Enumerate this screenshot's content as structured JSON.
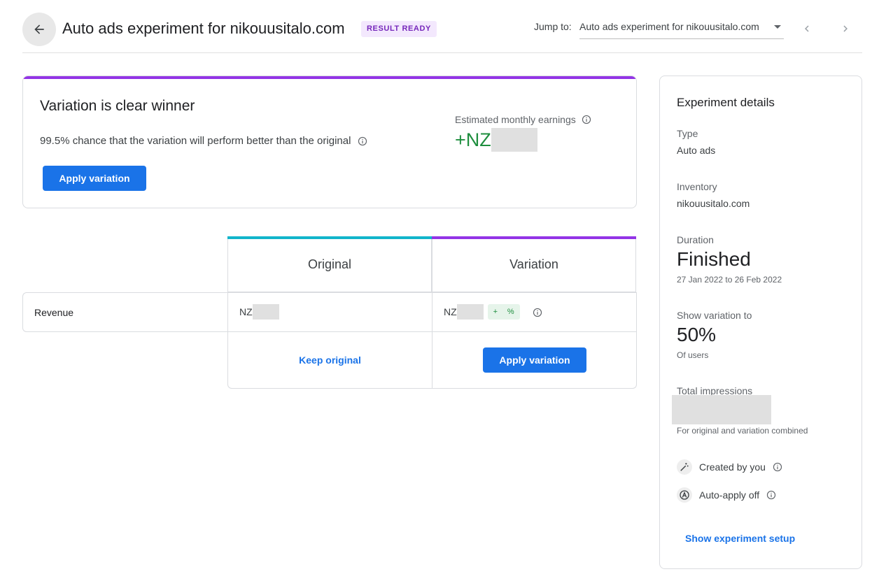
{
  "header": {
    "title": "Auto ads experiment for nikouusitalo.com",
    "status_badge": "RESULT READY",
    "jump_label": "Jump to:",
    "jump_value": "Auto ads experiment for nikouusitalo.com",
    "icons": [
      "arrow-back-icon",
      "chevron-left-icon",
      "chevron-right-icon",
      "dropdown-caret-icon"
    ]
  },
  "winner": {
    "title": "Variation is clear winner",
    "description": "99.5% chance that the variation will perform better than the original",
    "apply_label": "Apply variation",
    "earnings_label": "Estimated monthly earnings",
    "earnings_prefix": "+NZ",
    "accent_color": "#9334e6"
  },
  "comparison": {
    "columns": [
      {
        "label": "Original",
        "color": "#12b5cb"
      },
      {
        "label": "Variation",
        "color": "#9334e6"
      }
    ],
    "row_label": "Revenue",
    "original_value": "NZ",
    "variation_value": "NZ",
    "delta_sign": "+",
    "delta_unit": "%",
    "keep_label": "Keep original",
    "apply_label": "Apply variation"
  },
  "details": {
    "title": "Experiment details",
    "type_label": "Type",
    "type_value": "Auto ads",
    "inventory_label": "Inventory",
    "inventory_value": "nikouusitalo.com",
    "duration_label": "Duration",
    "duration_value": "Finished",
    "duration_dates": "27 Jan 2022 to 26 Feb 2022",
    "show_label": "Show variation to",
    "show_value": "50%",
    "show_sub": "Of users",
    "impressions_label": "Total impressions",
    "impressions_sub": "For original and variation combined",
    "created_label": "Created by you",
    "autoapply_label": "Auto-apply off",
    "setup_link": "Show experiment setup"
  },
  "colors": {
    "primary": "#1a73e8",
    "positive": "#1e8e3e",
    "badge_bg": "#f3e8fd",
    "badge_text": "#7627bb"
  }
}
